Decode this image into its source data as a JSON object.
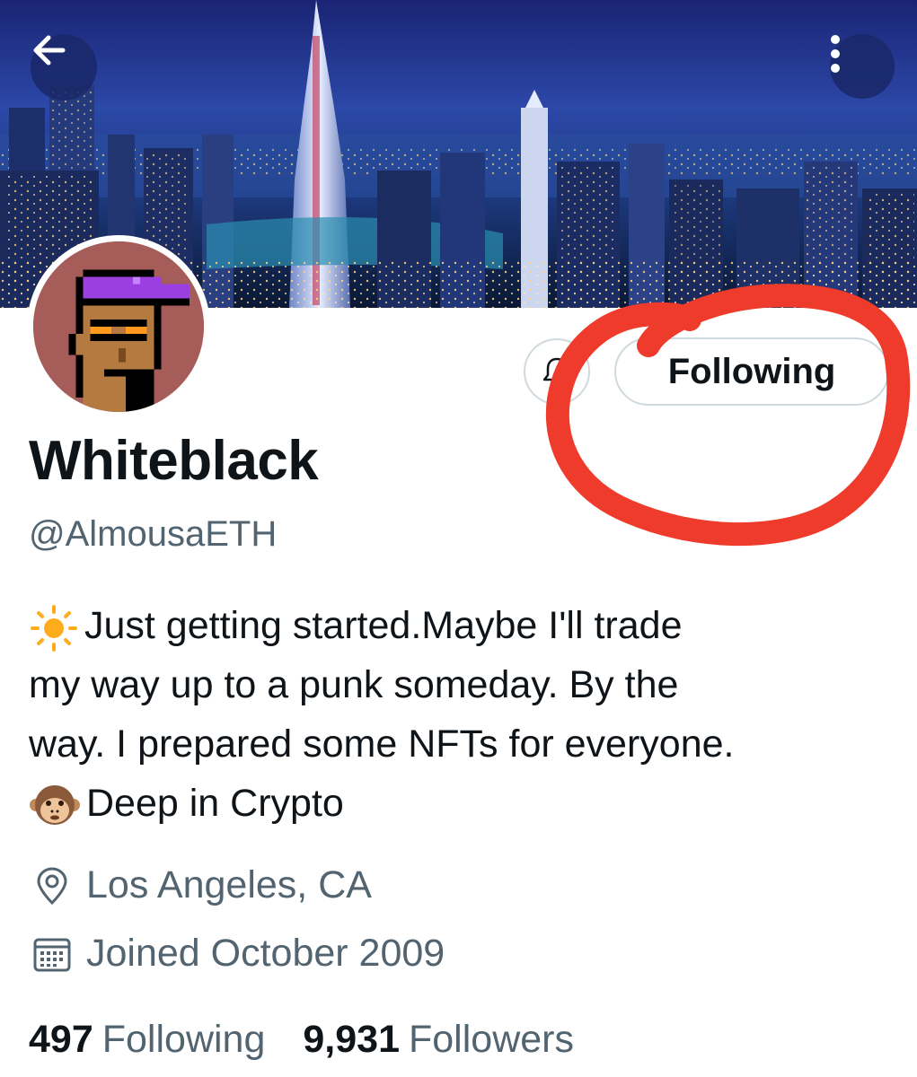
{
  "header": {
    "back_icon": "arrow-left-icon",
    "more_icon": "more-vertical-icon"
  },
  "actions": {
    "bell_icon": "bell-icon",
    "following_label": "Following"
  },
  "profile": {
    "display_name": "Whiteblack",
    "handle": "@AlmousaETH",
    "bio": {
      "line1": "Just getting started.Maybe I'll trade",
      "line2": "my way up to a punk someday. By the",
      "line3": "way. I prepared some NFTs for everyone.",
      "line4": "Deep in Crypto"
    },
    "location": "Los Angeles, CA",
    "joined": "Joined October 2009"
  },
  "stats": {
    "following_count": "497",
    "following_label": "Following",
    "followers_count": "9,931",
    "followers_label": "Followers"
  },
  "colors": {
    "text_primary": "#0f1419",
    "text_secondary": "#536471",
    "border": "#cfd9de",
    "annotation_red": "#ef3b2c"
  }
}
